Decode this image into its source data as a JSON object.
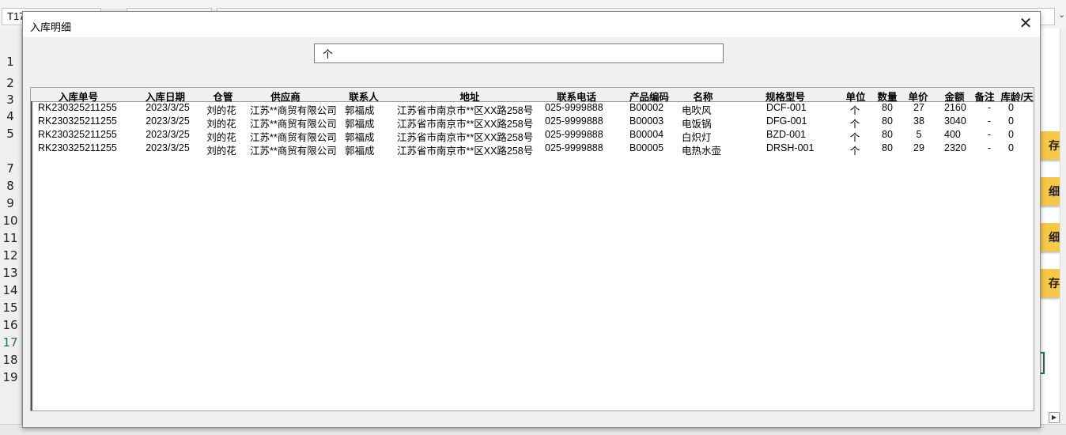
{
  "spreadsheet": {
    "name_box": "T17",
    "row_numbers": [
      "1",
      "2",
      "3",
      "4",
      "5",
      "7",
      "8",
      "9",
      "10",
      "11",
      "12",
      "13",
      "14",
      "15",
      "16",
      "17",
      "18",
      "19"
    ],
    "active_row": "17",
    "side_buttons": [
      "存",
      "细",
      "细",
      "存"
    ]
  },
  "dialog": {
    "title": "入库明细",
    "search_value": "个",
    "columns": [
      "入库单号",
      "入库日期",
      "仓管",
      "供应商",
      "联系人",
      "地址",
      "联系电话",
      "产品编码",
      "名称",
      "规格型号",
      "单位",
      "数量",
      "单价",
      "金额",
      "备注",
      "库龄/天"
    ],
    "rows": [
      [
        "RK230325211255",
        "2023/3/25",
        "刘的花",
        "江苏**商贸有限公司",
        "郭福成",
        "江苏省市南京市**区XX路258号",
        "025-9999888",
        "B00002",
        "电吹风",
        "DCF-001",
        "个",
        "80",
        "27",
        "2160",
        "-",
        "0"
      ],
      [
        "RK230325211255",
        "2023/3/25",
        "刘的花",
        "江苏**商贸有限公司",
        "郭福成",
        "江苏省市南京市**区XX路258号",
        "025-9999888",
        "B00003",
        "电饭锅",
        "DFG-001",
        "个",
        "80",
        "38",
        "3040",
        "-",
        "0"
      ],
      [
        "RK230325211255",
        "2023/3/25",
        "刘的花",
        "江苏**商贸有限公司",
        "郭福成",
        "江苏省市南京市**区XX路258号",
        "025-9999888",
        "B00004",
        "白炽灯",
        "BZD-001",
        "个",
        "80",
        "5",
        "400",
        "-",
        "0"
      ],
      [
        "RK230325211255",
        "2023/3/25",
        "刘的花",
        "江苏**商贸有限公司",
        "郭福成",
        "江苏省市南京市**区XX路258号",
        "025-9999888",
        "B00005",
        "电热水壶",
        "DRSH-001",
        "个",
        "80",
        "29",
        "2320",
        "-",
        "0"
      ]
    ]
  }
}
